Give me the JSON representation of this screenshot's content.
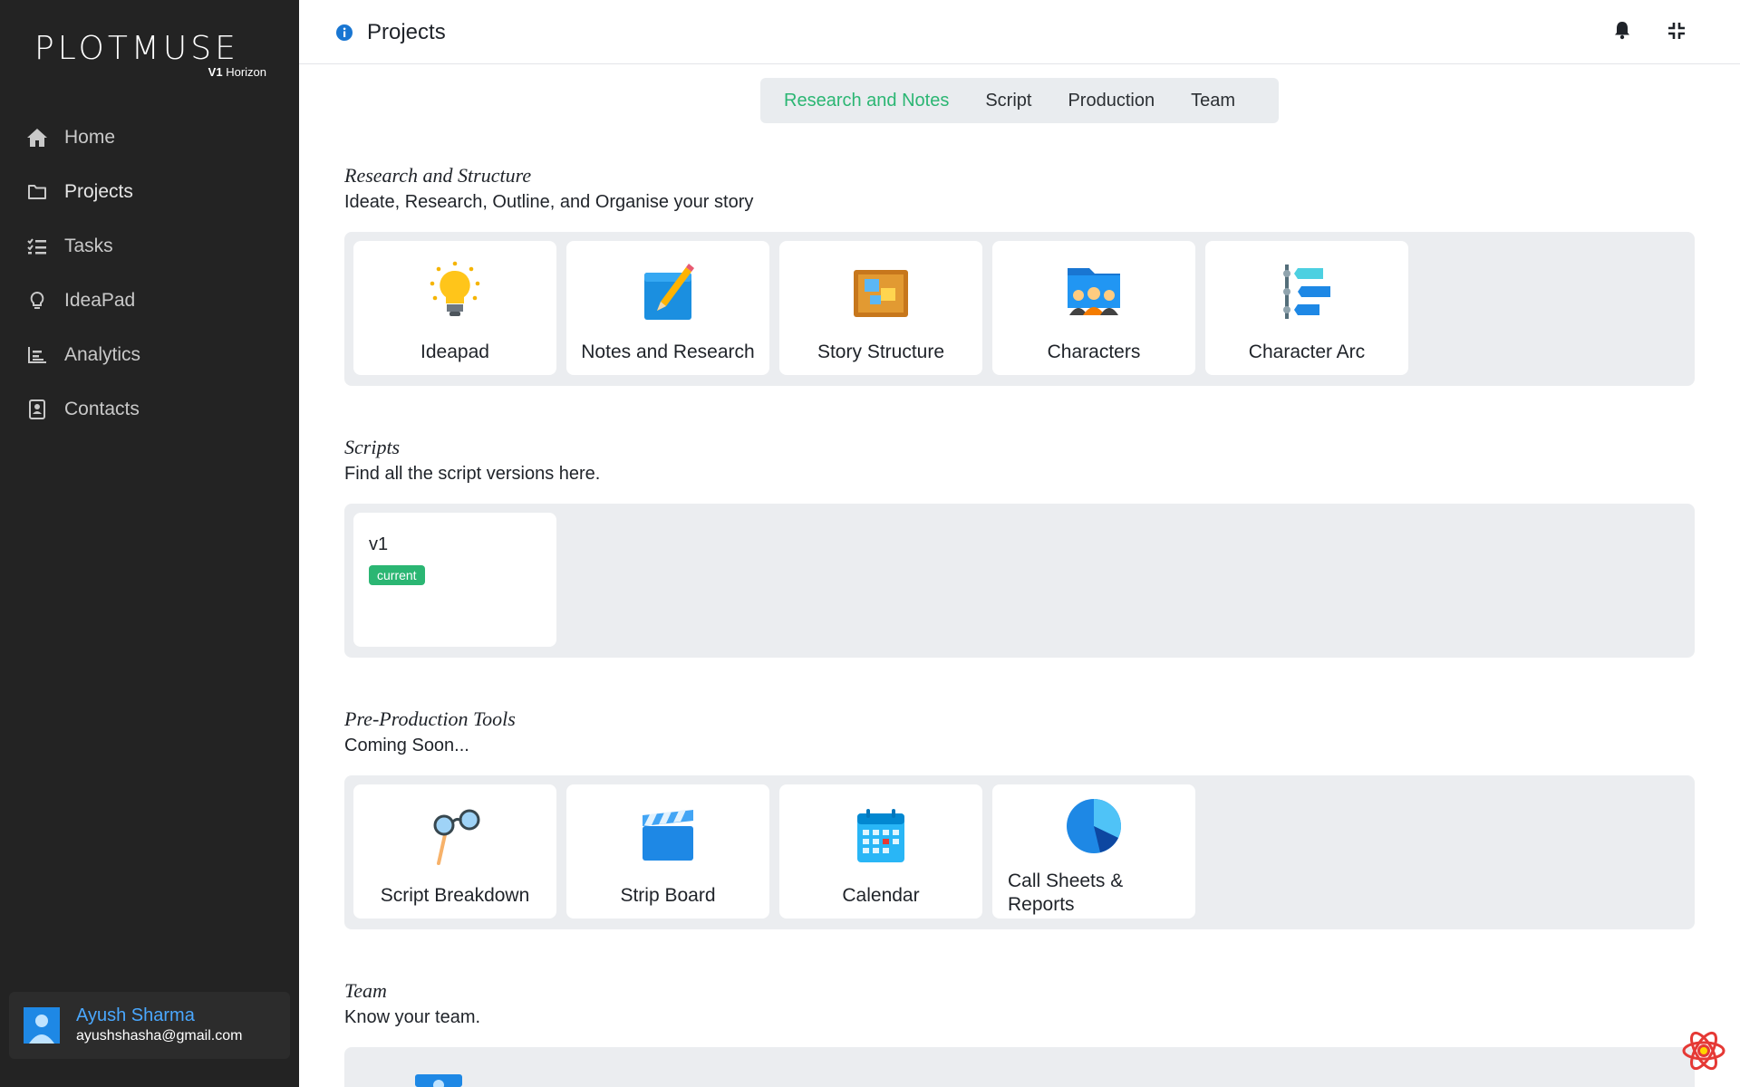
{
  "app": {
    "logo_text": "PLOTMUSE",
    "logo_version": "V1",
    "logo_edition": "Horizon"
  },
  "sidebar": {
    "items": [
      {
        "label": "Home",
        "icon": "home-icon"
      },
      {
        "label": "Projects",
        "icon": "folder-icon"
      },
      {
        "label": "Tasks",
        "icon": "checklist-icon"
      },
      {
        "label": "IdeaPad",
        "icon": "lightbulb-icon"
      },
      {
        "label": "Analytics",
        "icon": "chart-icon"
      },
      {
        "label": "Contacts",
        "icon": "contacts-icon"
      }
    ],
    "user": {
      "name": "Ayush Sharma",
      "email": "ayushshasha@gmail.com"
    }
  },
  "header": {
    "title": "Projects"
  },
  "tabs": [
    {
      "label": "Research and Notes",
      "active": true
    },
    {
      "label": "Script",
      "active": false
    },
    {
      "label": "Production",
      "active": false
    },
    {
      "label": "Team",
      "active": false
    }
  ],
  "research": {
    "title": "Research and Structure",
    "description": "Ideate, Research, Outline, and Organise your story",
    "cards": [
      {
        "label": "Ideapad",
        "icon": "lightbulb-icon"
      },
      {
        "label": "Notes and Research",
        "icon": "notepad-pencil-icon"
      },
      {
        "label": "Story Structure",
        "icon": "corkboard-icon"
      },
      {
        "label": "Characters",
        "icon": "people-icon"
      },
      {
        "label": "Character Arc",
        "icon": "arc-timeline-icon"
      }
    ]
  },
  "scripts": {
    "title": "Scripts",
    "description": "Find all the script versions here.",
    "versions": [
      {
        "name": "v1",
        "badge": "current"
      }
    ]
  },
  "preproduction": {
    "title": "Pre-Production Tools",
    "description": "Coming Soon...",
    "cards": [
      {
        "label": "Script Breakdown",
        "icon": "eyeglasses-icon"
      },
      {
        "label": "Strip Board",
        "icon": "clapperboard-icon"
      },
      {
        "label": "Calendar",
        "icon": "calendar-icon"
      },
      {
        "label": "Call Sheets & Reports",
        "icon": "pie-chart-icon"
      }
    ]
  },
  "team": {
    "title": "Team",
    "description": "Know your team."
  },
  "colors": {
    "sidebar_bg": "#232323",
    "accent_green": "#2bb673",
    "accent_blue": "#4aa8ff",
    "panel_bg": "#ebedf0"
  }
}
